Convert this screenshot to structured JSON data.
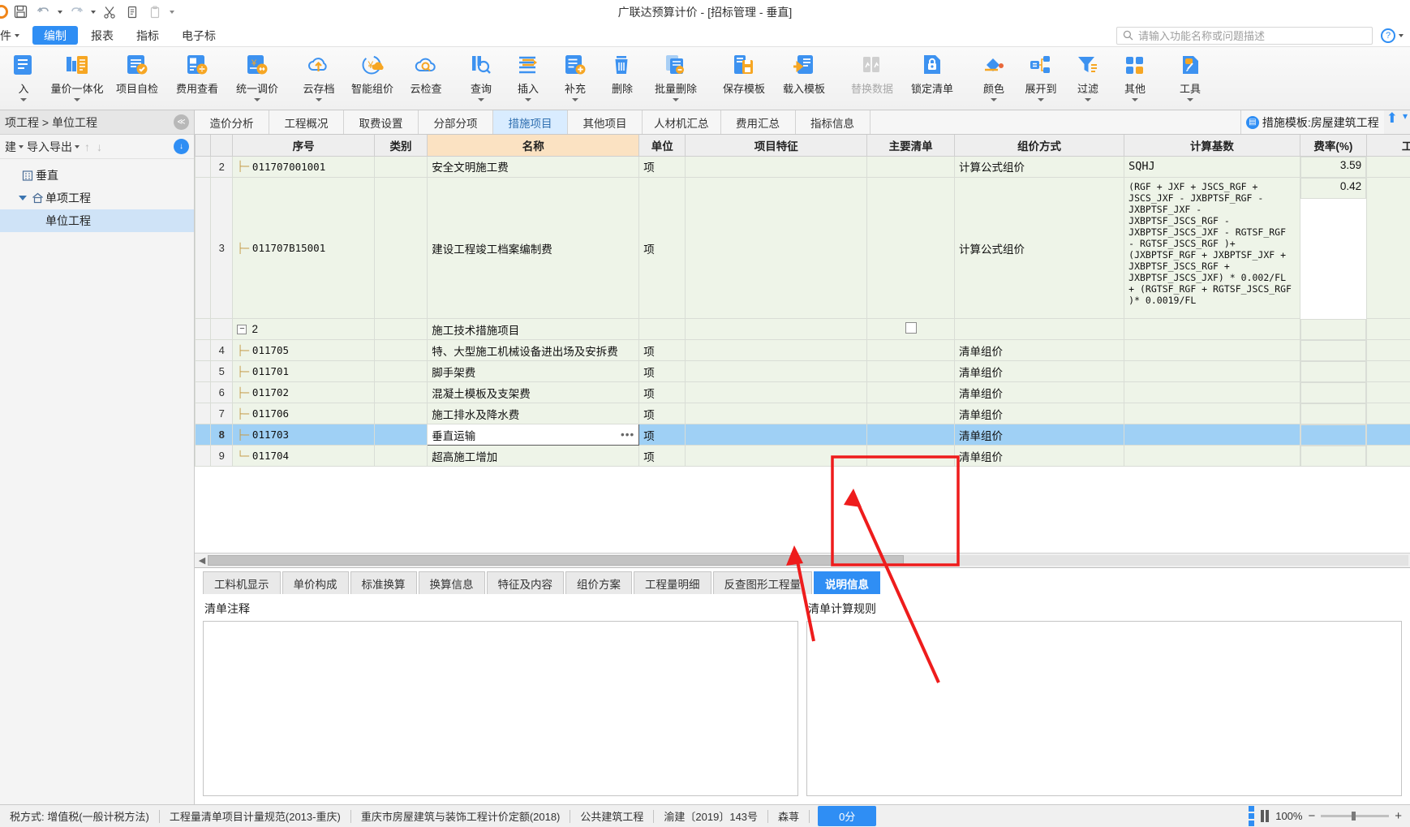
{
  "titlebar": {
    "app_title": "广联达预算计价 - [招标管理 - 垂直]",
    "quick_access": [
      {
        "name": "save-icon",
        "label": "保存"
      },
      {
        "name": "undo-icon",
        "label": "撤销"
      },
      {
        "name": "redo-icon",
        "label": "恢复"
      },
      {
        "name": "cut-icon",
        "label": "剪切"
      },
      {
        "name": "copy-icon",
        "label": "复制"
      },
      {
        "name": "paste-icon",
        "label": "粘贴"
      }
    ]
  },
  "menu": {
    "items": [
      {
        "label": "件",
        "caret": true,
        "active": false
      },
      {
        "label": "编制",
        "caret": false,
        "active": true
      },
      {
        "label": "报表",
        "caret": false,
        "active": false
      },
      {
        "label": "指标",
        "caret": false,
        "active": false
      },
      {
        "label": "电子标",
        "caret": false,
        "active": false
      }
    ],
    "search_placeholder": "请输入功能名称或问题描述",
    "help_label": "?"
  },
  "ribbon": {
    "buttons": [
      {
        "label": "入",
        "icon": "import-icon",
        "dropdown": true,
        "disabled": false
      },
      {
        "label": "量价一体化",
        "icon": "integration-icon",
        "dropdown": true,
        "disabled": false
      },
      {
        "label": "项目自检",
        "icon": "self-check-icon",
        "dropdown": false,
        "disabled": false
      },
      {
        "label": "费用查看",
        "icon": "cost-view-icon",
        "dropdown": false,
        "disabled": false
      },
      {
        "label": "统一调价",
        "icon": "unified-price-icon",
        "dropdown": true,
        "disabled": false
      },
      {
        "label": "云存档",
        "icon": "cloud-upload-icon",
        "dropdown": true,
        "disabled": false
      },
      {
        "label": "智能组价",
        "icon": "smart-price-icon",
        "dropdown": false,
        "disabled": false
      },
      {
        "label": "云检查",
        "icon": "cloud-check-icon",
        "dropdown": false,
        "disabled": false
      },
      {
        "label": "查询",
        "icon": "query-icon",
        "dropdown": true,
        "disabled": false
      },
      {
        "label": "插入",
        "icon": "insert-icon",
        "dropdown": true,
        "disabled": false
      },
      {
        "label": "补充",
        "icon": "supplement-icon",
        "dropdown": true,
        "disabled": false
      },
      {
        "label": "删除",
        "icon": "delete-icon",
        "dropdown": false,
        "disabled": false
      },
      {
        "label": "批量删除",
        "icon": "batch-delete-icon",
        "dropdown": true,
        "disabled": false
      },
      {
        "label": "保存模板",
        "icon": "save-template-icon",
        "dropdown": false,
        "disabled": false
      },
      {
        "label": "载入模板",
        "icon": "load-template-icon",
        "dropdown": false,
        "disabled": false
      },
      {
        "label": "替换数据",
        "icon": "replace-data-icon",
        "dropdown": false,
        "disabled": true
      },
      {
        "label": "锁定清单",
        "icon": "lock-list-icon",
        "dropdown": false,
        "disabled": false
      },
      {
        "label": "颜色",
        "icon": "color-icon",
        "dropdown": true,
        "disabled": false
      },
      {
        "label": "展开到",
        "icon": "expand-to-icon",
        "dropdown": true,
        "disabled": false
      },
      {
        "label": "过滤",
        "icon": "filter-icon",
        "dropdown": true,
        "disabled": false
      },
      {
        "label": "其他",
        "icon": "other-icon",
        "dropdown": true,
        "disabled": false
      },
      {
        "label": "工具",
        "icon": "tools-icon",
        "dropdown": true,
        "disabled": false
      }
    ]
  },
  "sidebar": {
    "breadcrumb": "项工程 > 单位工程",
    "collapse_label": "≪",
    "tools": [
      {
        "label": "建",
        "caret": true
      },
      {
        "label": "导入导出",
        "caret": true
      }
    ],
    "download_label": "↓",
    "tree": [
      {
        "label": "垂直",
        "level": 0,
        "icon": "building-icon",
        "selected": false,
        "expander": false
      },
      {
        "label": "单项工程",
        "level": 1,
        "icon": "home-icon",
        "selected": false,
        "expander": true
      },
      {
        "label": "单位工程",
        "level": 2,
        "icon": "none",
        "selected": true,
        "expander": false
      }
    ]
  },
  "tabs": {
    "items": [
      {
        "label": "造价分析",
        "active": false
      },
      {
        "label": "工程概况",
        "active": false
      },
      {
        "label": "取费设置",
        "active": false
      },
      {
        "label": "分部分项",
        "active": false
      },
      {
        "label": "措施项目",
        "active": true
      },
      {
        "label": "其他项目",
        "active": false
      },
      {
        "label": "人材机汇总",
        "active": false
      },
      {
        "label": "费用汇总",
        "active": false
      },
      {
        "label": "指标信息",
        "active": false
      }
    ],
    "template_badge": "措施模板:房屋建筑工程"
  },
  "grid": {
    "columns": [
      "序号",
      "类别",
      "名称",
      "单位",
      "项目特征",
      "主要清单",
      "组价方式",
      "计算基数",
      "费率(%)",
      "工程量"
    ],
    "rows": [
      {
        "idx": "2",
        "code": "011707001001",
        "category": "",
        "name": "安全文明施工费",
        "unit": "项",
        "feature": "",
        "main_list": "",
        "method": "计算公式组价",
        "base": "SQHJ",
        "rate": "3.59",
        "qty": "",
        "selected": false,
        "kind": "leaf",
        "tall": false,
        "checkbox": false
      },
      {
        "idx": "3",
        "code": "011707B15001",
        "category": "",
        "name": "建设工程竣工档案编制费",
        "unit": "项",
        "feature": "",
        "main_list": "",
        "method": "计算公式组价",
        "base": "(RGF + JXF + JSCS_RGF +\nJSCS_JXF - JXBPTSF_RGF -\nJXBPTSF_JXF -\nJXBPTSF_JSCS_RGF -\nJXBPTSF_JSCS_JXF - RGTSF_RGF\n- RGTSF_JSCS_RGF )+\n(JXBPTSF_RGF + JXBPTSF_JXF +\nJXBPTSF_JSCS_RGF +\nJXBPTSF_JSCS_JXF) * 0.002/FL\n+ (RGTSF_RGF + RGTSF_JSCS_RGF\n)* 0.0019/FL",
        "rate": "0.42",
        "qty": "",
        "selected": false,
        "kind": "leaf",
        "tall": true,
        "checkbox": false
      },
      {
        "idx": "",
        "code": "2",
        "category": "",
        "name": "施工技术措施项目",
        "unit": "",
        "feature": "",
        "main_list": "",
        "method": "",
        "base": "",
        "rate": "",
        "qty": "",
        "selected": false,
        "kind": "group",
        "tall": false,
        "checkbox": true
      },
      {
        "idx": "4",
        "code": "011705",
        "category": "",
        "name": "特、大型施工机械设备进出场及安拆费",
        "unit": "项",
        "feature": "",
        "main_list": "",
        "method": "清单组价",
        "base": "",
        "rate": "",
        "qty": "",
        "selected": false,
        "kind": "leaf",
        "tall": false,
        "checkbox": false
      },
      {
        "idx": "5",
        "code": "011701",
        "category": "",
        "name": "脚手架费",
        "unit": "项",
        "feature": "",
        "main_list": "",
        "method": "清单组价",
        "base": "",
        "rate": "",
        "qty": "",
        "selected": false,
        "kind": "leaf",
        "tall": false,
        "checkbox": false
      },
      {
        "idx": "6",
        "code": "011702",
        "category": "",
        "name": "混凝土模板及支架费",
        "unit": "项",
        "feature": "",
        "main_list": "",
        "method": "清单组价",
        "base": "",
        "rate": "",
        "qty": "",
        "selected": false,
        "kind": "leaf",
        "tall": false,
        "checkbox": false
      },
      {
        "idx": "7",
        "code": "011706",
        "category": "",
        "name": "施工排水及降水费",
        "unit": "项",
        "feature": "",
        "main_list": "",
        "method": "清单组价",
        "base": "",
        "rate": "",
        "qty": "",
        "selected": false,
        "kind": "leaf",
        "tall": false,
        "checkbox": false
      },
      {
        "idx": "8",
        "code": "011703",
        "category": "",
        "name": "垂直运输",
        "unit": "项",
        "feature": "",
        "main_list": "",
        "method": "清单组价",
        "base": "",
        "rate": "",
        "qty": "",
        "selected": true,
        "kind": "leaf",
        "tall": false,
        "checkbox": false,
        "has_ellipsis": true
      },
      {
        "idx": "9",
        "code": "011704",
        "category": "",
        "name": "超高施工增加",
        "unit": "项",
        "feature": "",
        "main_list": "",
        "method": "清单组价",
        "base": "",
        "rate": "",
        "qty": "",
        "selected": false,
        "kind": "leaf",
        "tall": false,
        "checkbox": false
      }
    ]
  },
  "bottom": {
    "tabs": [
      {
        "label": "工料机显示",
        "active": false
      },
      {
        "label": "单价构成",
        "active": false
      },
      {
        "label": "标准换算",
        "active": false
      },
      {
        "label": "换算信息",
        "active": false
      },
      {
        "label": "特征及内容",
        "active": false
      },
      {
        "label": "组价方案",
        "active": false
      },
      {
        "label": "工程量明细",
        "active": false
      },
      {
        "label": "反查图形工程量",
        "active": false
      },
      {
        "label": "说明信息",
        "active": true
      }
    ],
    "left_title": "清单注释",
    "left_value": "",
    "right_title": "清单计算规则",
    "right_value": ""
  },
  "status": {
    "items": [
      "税方式: 增值税(一般计税方法)",
      "工程量清单项目计量规范(2013-重庆)",
      "重庆市房屋建筑与装饰工程计价定额(2018)",
      "公共建筑工程",
      "渝建〔2019〕143号",
      "森荨"
    ],
    "score": "0分",
    "zoom": "100%"
  },
  "colors": {
    "accent": "#2f8ef4",
    "brand_orange": "#f08519",
    "annotation_red": "#ee1c1c",
    "name_header": "#fbe2c2",
    "row_bg": "#eef4e8",
    "row_selected": "#9fd0f5"
  }
}
